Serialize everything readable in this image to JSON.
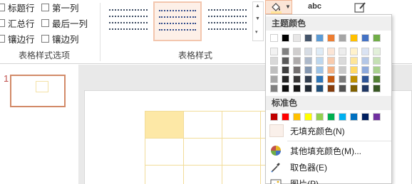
{
  "options": {
    "header_row": "标题行",
    "first_column": "第一列",
    "total_row": "汇总行",
    "last_column": "最后一列",
    "banded_rows": "镶边行",
    "banded_columns": "镶边列"
  },
  "groups": {
    "table_style_options": "表格样式选项",
    "table_styles": "表格样式"
  },
  "toolbar": {
    "wordart_label": "abc",
    "fill_color": "#fbe5d6"
  },
  "slides": {
    "number": "1"
  },
  "dropdown": {
    "theme_colors_title": "主题颜色",
    "standard_colors_title": "标准色",
    "no_fill": "无填充颜色(N)",
    "more_colors": "其他填充颜色(M)...",
    "eyedropper": "取色器(E)",
    "picture": "图片(P)..."
  },
  "theme_colors": {
    "top": [
      "#ffffff",
      "#000000",
      "#e7e6e6",
      "#44546a",
      "#5b9bd5",
      "#ed7d31",
      "#a5a5a5",
      "#ffc000",
      "#4472c4",
      "#70ad47"
    ],
    "shades": [
      [
        "#f2f2f2",
        "#808080",
        "#d0cece",
        "#d6dce4",
        "#deebf6",
        "#fbe5d6",
        "#ededed",
        "#fff2cc",
        "#dae3f3",
        "#e2f0d9"
      ],
      [
        "#d9d9d9",
        "#595959",
        "#aeabab",
        "#adb9ca",
        "#bdd7ee",
        "#f8cbad",
        "#dbdbdb",
        "#fee599",
        "#b4c7e7",
        "#c5e0b4"
      ],
      [
        "#bfbfbf",
        "#404040",
        "#757171",
        "#8497b0",
        "#9dc3e6",
        "#f4b183",
        "#c9c9c9",
        "#ffd966",
        "#8faadc",
        "#a9d18e"
      ],
      [
        "#a6a6a6",
        "#262626",
        "#3a3838",
        "#333f50",
        "#2e75b6",
        "#c55a11",
        "#7b7b7b",
        "#bf9000",
        "#2f5597",
        "#538135"
      ],
      [
        "#7f7f7f",
        "#0d0d0d",
        "#171616",
        "#222a35",
        "#1f4e79",
        "#843c0c",
        "#525252",
        "#7f6000",
        "#203864",
        "#385723"
      ]
    ],
    "selected": "#ffe699"
  },
  "standard_colors": [
    "#c00000",
    "#ff0000",
    "#ffc000",
    "#ffff00",
    "#92d050",
    "#00b050",
    "#00b0f0",
    "#0070c0",
    "#002060",
    "#7030a0"
  ]
}
